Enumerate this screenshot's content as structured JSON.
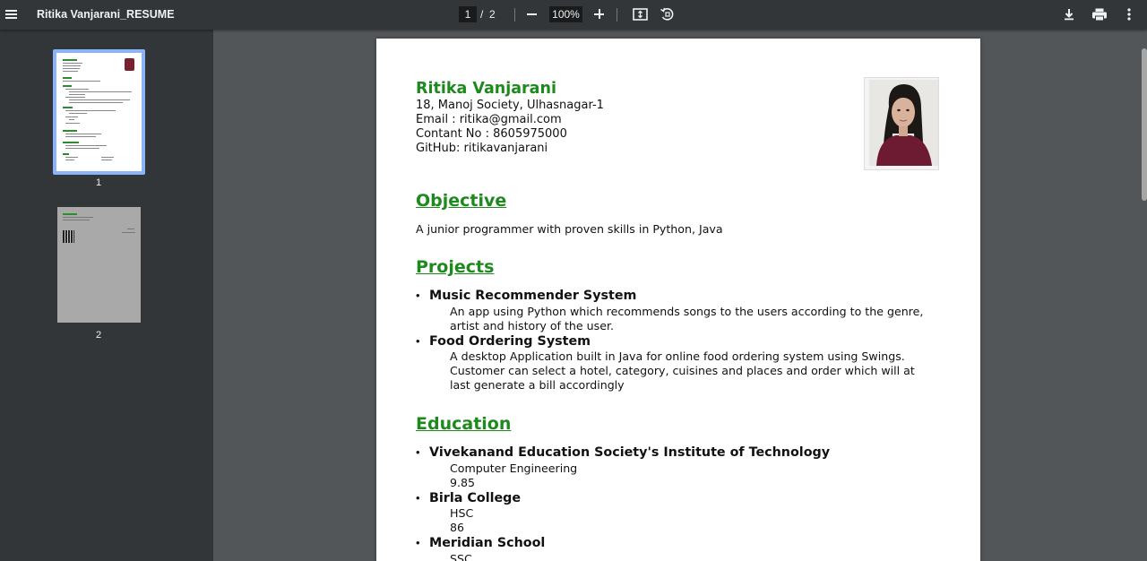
{
  "toolbar": {
    "title": "Ritika Vanjarani_RESUME",
    "current_page": "1",
    "page_separator": "/",
    "total_pages": "2",
    "zoom": "100%"
  },
  "sidebar": {
    "thumbnails": [
      {
        "label": "1",
        "selected": true
      },
      {
        "label": "2",
        "selected": false
      }
    ]
  },
  "resume": {
    "name": "Ritika Vanjarani",
    "address": "18, Manoj Society, Ulhasnagar-1",
    "email": "Email : ritika@gmail.com",
    "contact": "Contant No : 8605975000",
    "github": "GitHub: ritikavanjarani",
    "objective_heading": "Objective",
    "objective_text": "A junior programmer with proven skills in Python, Java",
    "projects_heading": "Projects",
    "projects": [
      {
        "title": "Music Recommender System",
        "description": "An app using Python which recommends songs to the users according to the genre, artist and history of the user."
      },
      {
        "title": "Food Ordering System",
        "description": "A desktop Application built in Java for online food ordering system using Swings. Customer can select a hotel, category, cuisines and places and order which will at last generate a bill accordingly"
      }
    ],
    "education_heading": "Education",
    "education": [
      {
        "title": "Vivekanand Education Society's Institute of Technology",
        "line1": "Computer Engineering",
        "line2": "9.85"
      },
      {
        "title": "Birla College",
        "line1": "HSC",
        "line2": "86"
      },
      {
        "title": "Meridian School",
        "line1": "SSC",
        "line2": ""
      }
    ],
    "bullet": "•"
  },
  "colors": {
    "accent_green": "#1e8a1e",
    "toolbar_bg": "#323639",
    "viewer_bg": "#525659",
    "thumb_selected": "#8ab4f8"
  }
}
